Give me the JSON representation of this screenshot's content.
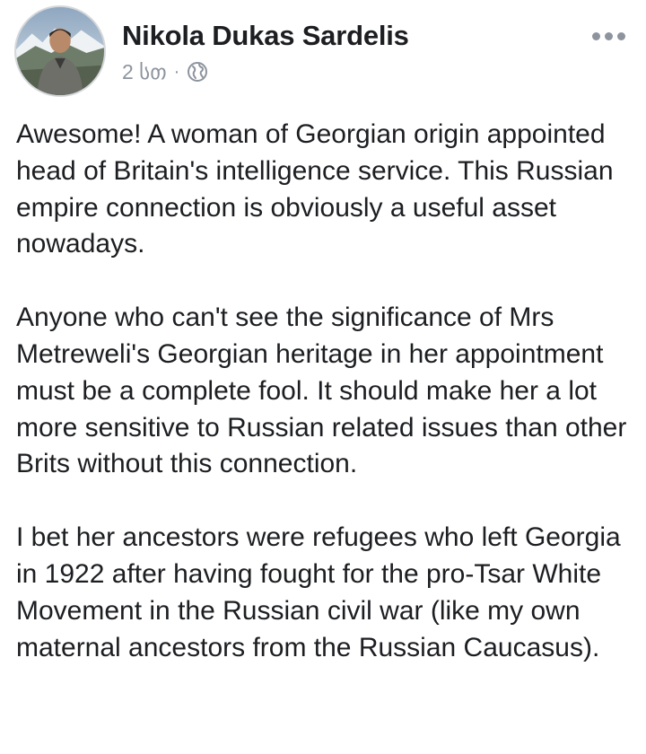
{
  "post": {
    "author": {
      "name": "Nikola Dukas Sardelis",
      "avatar_icon": "profile-photo"
    },
    "timestamp": "2 სთ",
    "separator": "·",
    "privacy_icon": "globe-icon",
    "more_icon": "more-options-icon",
    "paragraphs": [
      "Awesome! A woman of Georgian origin appointed head of Britain's intelligence service. This Russian empire connection is obviously a useful asset nowadays.",
      "Anyone who can't see the significance of Mrs Metreweli's Georgian heritage in her appointment must be a complete fool. It should make her a lot more sensitive to Russian related issues than other Brits without this connection.",
      "I bet her ancestors were refugees who left Georgia in 1922 after having fought for the pro-Tsar White Movement in the Russian civil war (like my own maternal ancestors from the Russian Caucasus)."
    ]
  },
  "colors": {
    "text": "#1c1e21",
    "secondary_text": "#8d949e",
    "background": "#ffffff"
  }
}
